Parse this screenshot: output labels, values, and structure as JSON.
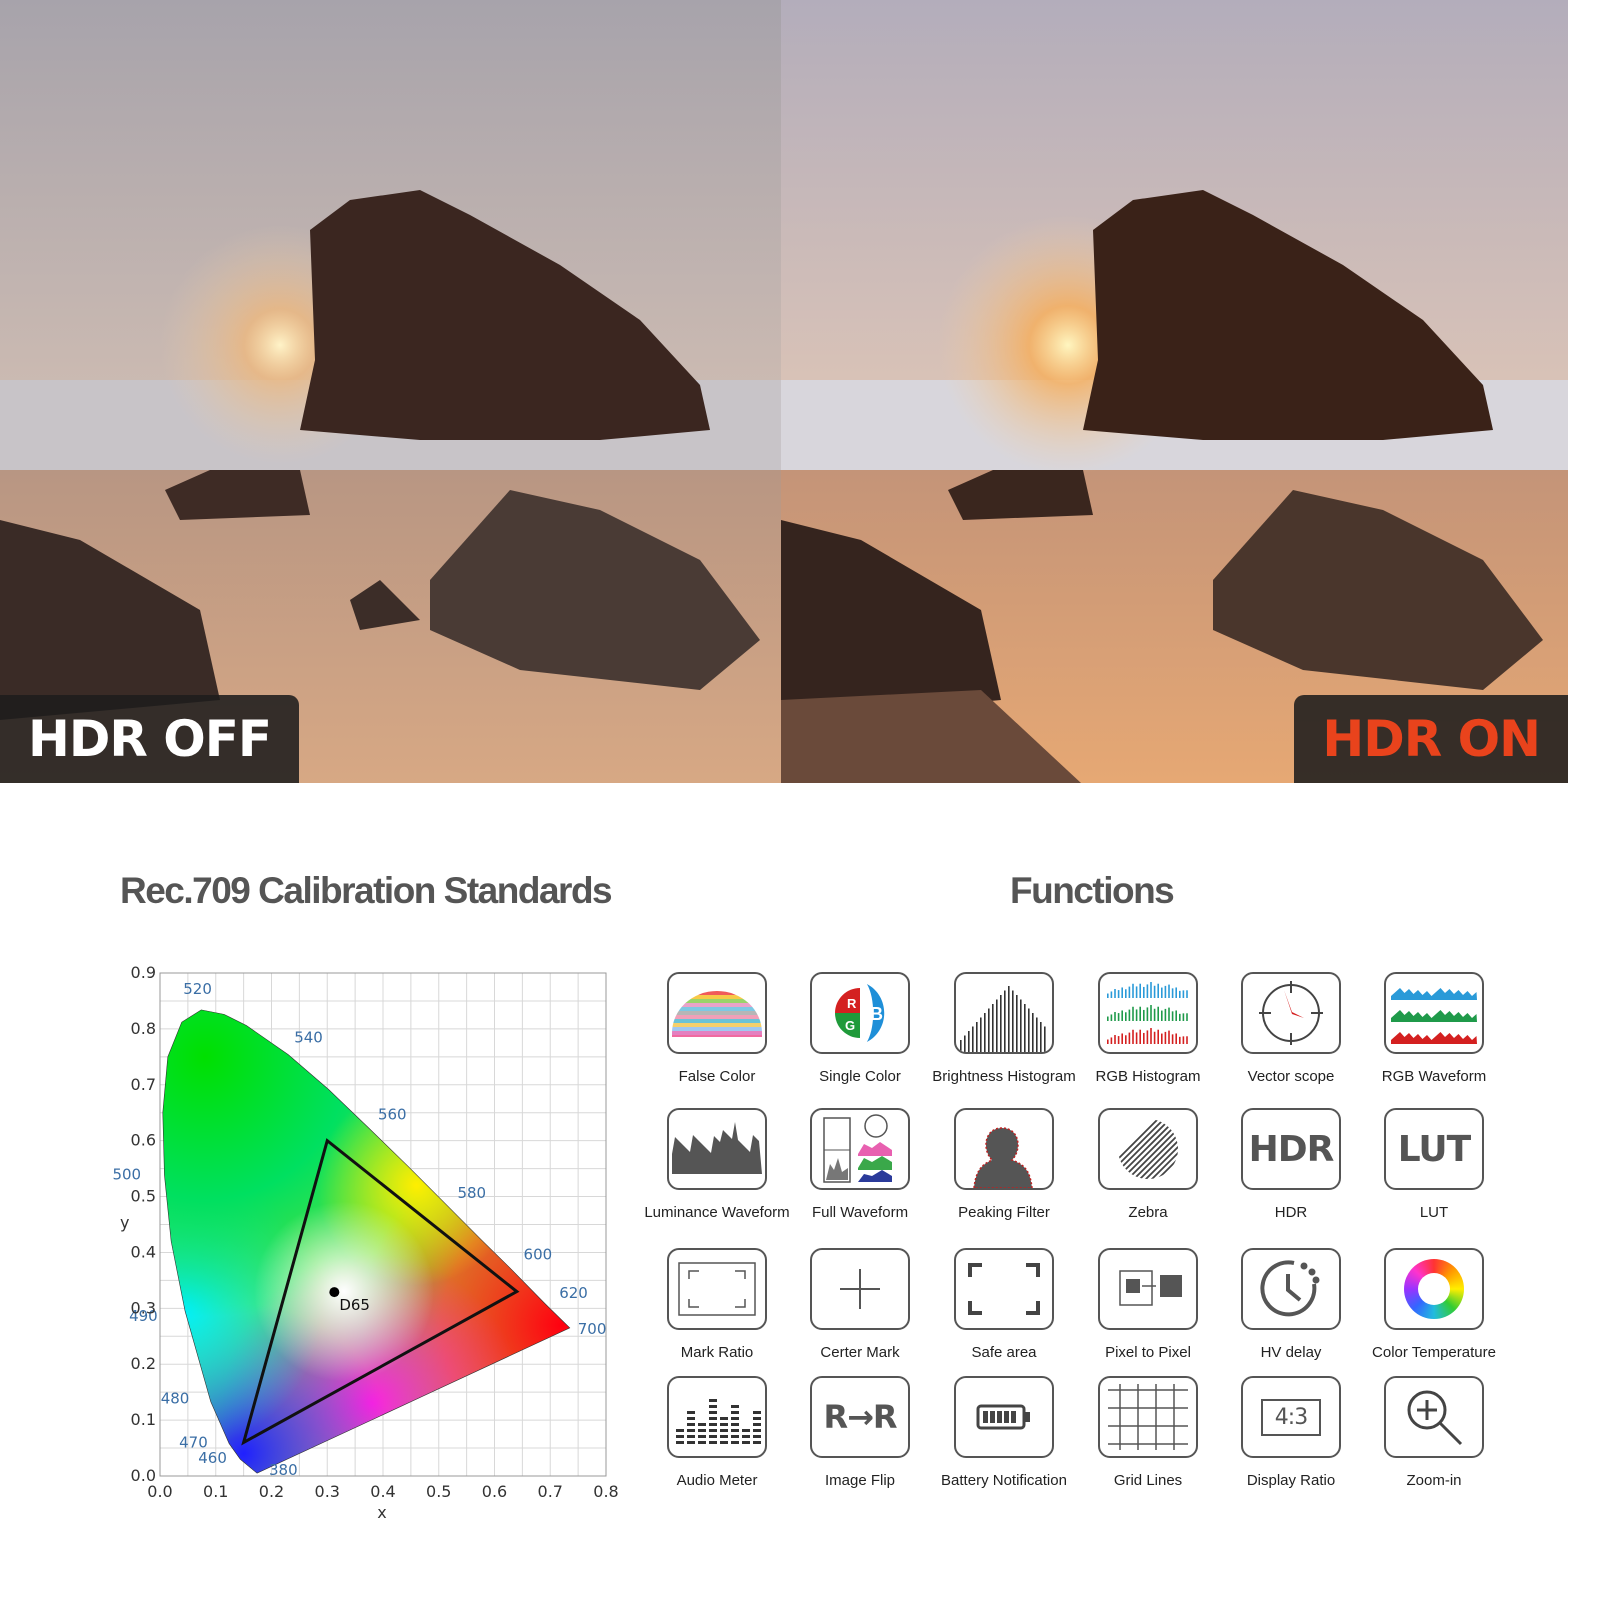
{
  "comparison": {
    "left_label": "HDR OFF",
    "right_label": "HDR ON",
    "left_label_color": "#ffffff",
    "right_label_color": "#e9431c"
  },
  "calibration": {
    "title": "Rec.709 Calibration Standards"
  },
  "functions": {
    "title": "Functions",
    "items": [
      {
        "label": "False Color",
        "icon": "false-color-icon"
      },
      {
        "label": "Single Color",
        "icon": "single-color-icon"
      },
      {
        "label": "Brightness Histogram",
        "icon": "brightness-histogram-icon"
      },
      {
        "label": "RGB Histogram",
        "icon": "rgb-histogram-icon"
      },
      {
        "label": "Vector scope",
        "icon": "vector-scope-icon"
      },
      {
        "label": "RGB Waveform",
        "icon": "rgb-waveform-icon"
      },
      {
        "label": "Luminance Waveform",
        "icon": "luminance-waveform-icon"
      },
      {
        "label": "Full Waveform",
        "icon": "full-waveform-icon"
      },
      {
        "label": "Peaking Filter",
        "icon": "peaking-filter-icon"
      },
      {
        "label": "Zebra",
        "icon": "zebra-icon"
      },
      {
        "label": "HDR",
        "icon": "hdr-icon",
        "glyph": "HDR"
      },
      {
        "label": "LUT",
        "icon": "lut-icon",
        "glyph": "LUT"
      },
      {
        "label": "Mark Ratio",
        "icon": "mark-ratio-icon"
      },
      {
        "label": "Certer Mark",
        "icon": "center-mark-icon"
      },
      {
        "label": "Safe area",
        "icon": "safe-area-icon"
      },
      {
        "label": "Pixel to Pixel",
        "icon": "pixel-to-pixel-icon"
      },
      {
        "label": "HV delay",
        "icon": "hv-delay-icon"
      },
      {
        "label": "Color Temperature",
        "icon": "color-temperature-icon"
      },
      {
        "label": "Audio Meter",
        "icon": "audio-meter-icon"
      },
      {
        "label": "Image Flip",
        "icon": "image-flip-icon",
        "glyph": "R→R"
      },
      {
        "label": "Battery Notification",
        "icon": "battery-icon"
      },
      {
        "label": "Grid Lines",
        "icon": "grid-lines-icon"
      },
      {
        "label": "Display Ratio",
        "icon": "display-ratio-icon",
        "glyph": "4:3"
      },
      {
        "label": "Zoom-in",
        "icon": "zoom-in-icon"
      }
    ]
  },
  "chart_data": {
    "type": "scatter",
    "xlabel": "x",
    "ylabel": "y",
    "xlim": [
      0,
      0.8
    ],
    "ylim": [
      0,
      0.9
    ],
    "xticks": [
      "0.0",
      "0.1",
      "0.2",
      "0.3",
      "0.4",
      "0.5",
      "0.6",
      "0.7",
      "0.8"
    ],
    "yticks": [
      "0.0",
      "0.1",
      "0.2",
      "0.3",
      "0.4",
      "0.5",
      "0.6",
      "0.7",
      "0.8",
      "0.9"
    ],
    "grid": true,
    "wavelength_labels": [
      {
        "label": "380",
        "x": 0.174,
        "y": 0.005
      },
      {
        "label": "460",
        "x": 0.144,
        "y": 0.03
      },
      {
        "label": "470",
        "x": 0.124,
        "y": 0.058
      },
      {
        "label": "480",
        "x": 0.091,
        "y": 0.133
      },
      {
        "label": "490",
        "x": 0.045,
        "y": 0.295
      },
      {
        "label": "500",
        "x": 0.008,
        "y": 0.538
      },
      {
        "label": "520",
        "x": 0.074,
        "y": 0.834
      },
      {
        "label": "540",
        "x": 0.23,
        "y": 0.754
      },
      {
        "label": "560",
        "x": 0.373,
        "y": 0.624
      },
      {
        "label": "580",
        "x": 0.512,
        "y": 0.487
      },
      {
        "label": "600",
        "x": 0.627,
        "y": 0.373
      },
      {
        "label": "620",
        "x": 0.691,
        "y": 0.308
      },
      {
        "label": "700",
        "x": 0.735,
        "y": 0.265
      }
    ],
    "gamut_triangle": [
      {
        "x": 0.64,
        "y": 0.33
      },
      {
        "x": 0.3,
        "y": 0.6
      },
      {
        "x": 0.15,
        "y": 0.06
      }
    ],
    "white_point": {
      "label": "D65",
      "x": 0.3127,
      "y": 0.329
    },
    "label_color": "#3a6ea5"
  }
}
